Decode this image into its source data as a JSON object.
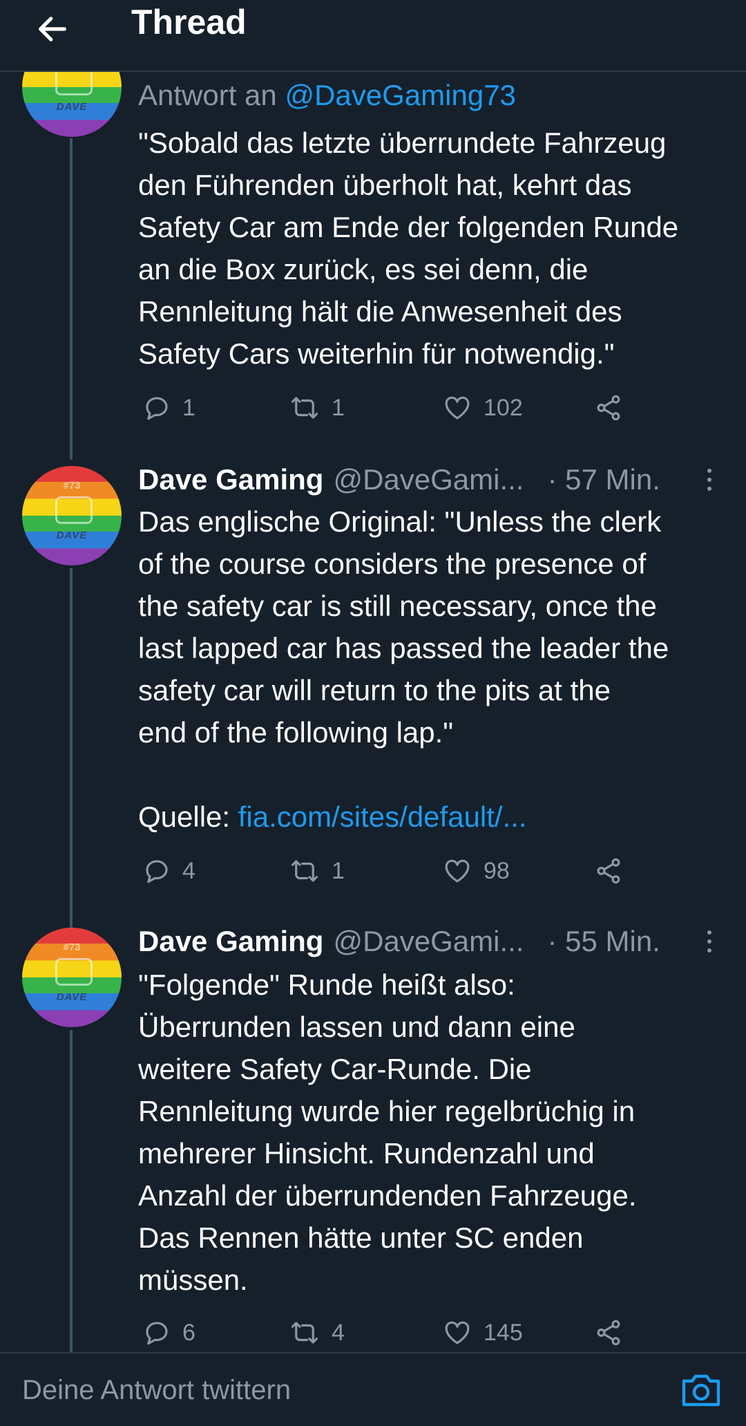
{
  "header": {
    "title": "Thread",
    "back_icon": "arrow-left-icon"
  },
  "tweets": [
    {
      "reply_prefix": "Antwort an ",
      "reply_handle": "@DaveGaming73",
      "lines": [
        "\"Sobald das letzte überrundete Fahrzeug",
        "den Führenden überholt hat, kehrt das",
        "Safety Car am Ende der folgenden Runde",
        "an die Box zurück, es sei denn, die",
        "Rennleitung hält die Anwesenheit des",
        "Safety Cars weiterhin für notwendig.\""
      ],
      "replies": "1",
      "retweets": "1",
      "likes": "102"
    },
    {
      "name": "Dave Gaming",
      "handle": "@DaveGami...",
      "time": "· 57 Min.",
      "avatar_text": "DAVE",
      "avatar_number": "#73",
      "lines": [
        "Das englische Original: \"Unless the clerk",
        "of the course considers the presence of",
        "the safety car is still necessary, once the",
        "last lapped car has passed the leader the",
        "safety car will return to the pits at the",
        "end of the following lap.\""
      ],
      "source_label": "Quelle: ",
      "source_link": "fia.com/sites/default/...",
      "replies": "4",
      "retweets": "1",
      "likes": "98"
    },
    {
      "name": "Dave Gaming",
      "handle": "@DaveGami...",
      "time": "· 55 Min.",
      "avatar_text": "DAVE",
      "avatar_number": "#73",
      "lines": [
        "\"Folgende\" Runde heißt also:",
        "Überrunden lassen und dann eine",
        "weitere Safety Car-Runde. Die",
        "Rennleitung wurde hier regelbrüchig in",
        "mehrerer Hinsicht. Rundenzahl und",
        "Anzahl der überrundenden Fahrzeuge.",
        "Das Rennen hätte unter SC enden",
        "müssen."
      ],
      "replies": "6",
      "retweets": "4",
      "likes": "145"
    }
  ],
  "first_avatar_text": "DAVE",
  "compose": {
    "placeholder": "Deine Antwort twittern",
    "camera_icon": "camera-icon"
  },
  "colors": {
    "background": "#15202b",
    "accent": "#1d9bf0",
    "muted": "#8b98a5",
    "divider": "#2f3a45"
  }
}
